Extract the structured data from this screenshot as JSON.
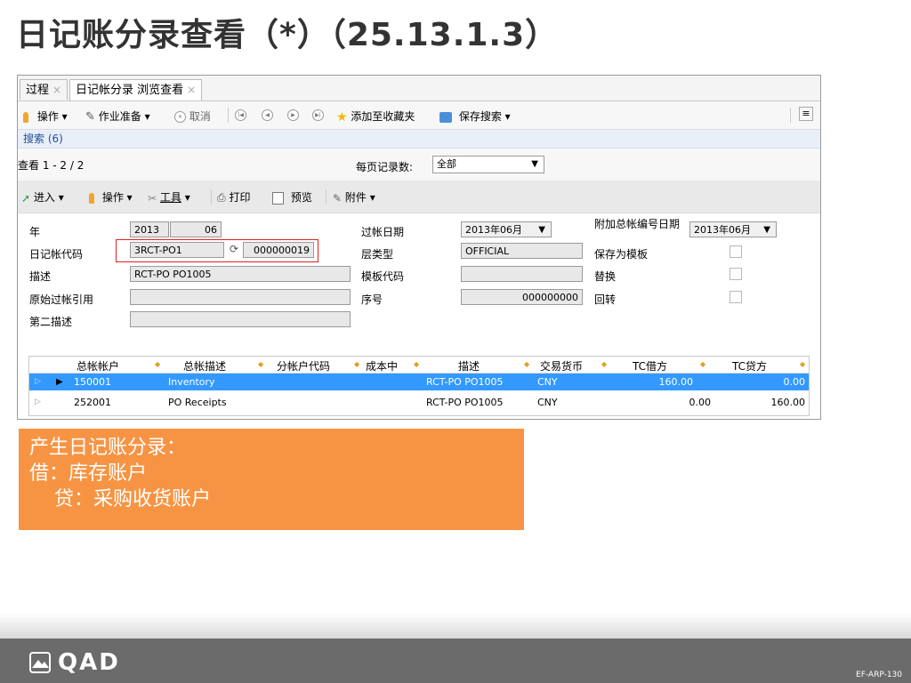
{
  "slide": {
    "title": "日记账分录查看（*）（25.13.1.3）",
    "code": "EF-ARP-130",
    "logo_text": "QAD"
  },
  "tabs": [
    {
      "label": "过程",
      "close": "×"
    },
    {
      "label": "日记帐分录 浏览查看",
      "close": "×"
    }
  ],
  "toolbar1": {
    "actions": "操作",
    "work": "作业准备",
    "cancel": "取消",
    "favorite": "添加至收藏夹",
    "save_search": "保存搜索"
  },
  "search": {
    "label": "搜索 (6)"
  },
  "view": {
    "range": "查看 1 - 2 / 2",
    "per_page_label": "每页记录数:",
    "per_page_value": "全部"
  },
  "toolbar2": {
    "enter": "进入",
    "actions": "操作",
    "tools": "工具",
    "print": "打印",
    "preview": "预览",
    "attach": "附件"
  },
  "form": {
    "year_label": "年",
    "year": "2013",
    "period": "06",
    "journal_code_label": "日记帐代码",
    "journal_code": "3RCT-PO1",
    "journal_num": "000000019",
    "desc_label": "描述",
    "desc": "RCT-PO PO1005",
    "orig_ref_label": "原始过帐引用",
    "orig_ref": "",
    "desc2_label": "第二描述",
    "desc2": "",
    "post_date_label": "过帐日期",
    "post_date": "2013年06月",
    "layer_label": "层类型",
    "layer": "OFFICIAL",
    "template_code_label": "模板代码",
    "template_code": "",
    "seq_label": "序号",
    "seq": "000000000",
    "gl_date_label": "附加总帐编号日期",
    "gl_date": "2013年06月",
    "save_template_label": "保存为模板",
    "replace_label": "替换",
    "reverse_label": "回转"
  },
  "grid": {
    "columns": [
      "总帐帐户",
      "总帐描述",
      "分帐户代码",
      "成本中",
      "描述",
      "交易货币",
      "TC借方",
      "TC贷方"
    ],
    "rows": [
      {
        "account": "150001",
        "gl_desc": "Inventory",
        "sub": "",
        "cc": "",
        "desc": "RCT-PO PO1005",
        "currency": "CNY",
        "debit": "160.00",
        "credit": "0.00"
      },
      {
        "account": "252001",
        "gl_desc": "PO Receipts",
        "sub": "",
        "cc": "",
        "desc": "RCT-PO PO1005",
        "currency": "CNY",
        "debit": "0.00",
        "credit": "160.00"
      }
    ]
  },
  "callout": {
    "line1": "产生日记账分录：",
    "line2": "借：库存账户",
    "line3": "    贷：采购收货账户"
  }
}
